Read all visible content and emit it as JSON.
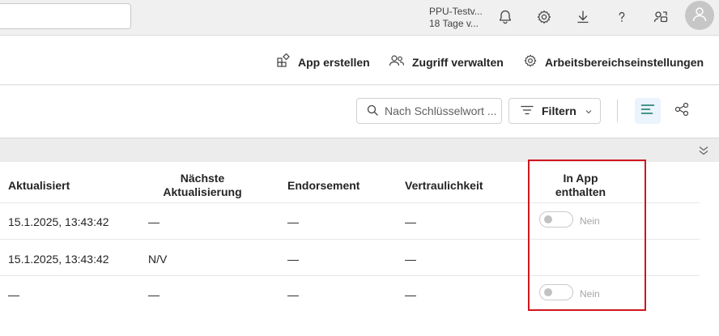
{
  "topbar": {
    "trial_line1": "PPU-Testv...",
    "trial_line2": "18 Tage v...",
    "icons": [
      "bell-icon",
      "gear-icon",
      "download-icon",
      "help-icon",
      "share-icon",
      "user-icon"
    ]
  },
  "actionbar": {
    "create_app": "App erstellen",
    "manage_access": "Zugriff verwalten",
    "workspace_settings": "Arbeitsbereichseinstellungen"
  },
  "toolbar": {
    "search_placeholder": "Nach Schlüsselwort ...",
    "filter_label": "Filtern"
  },
  "table": {
    "columns": {
      "updated": "Aktualisiert",
      "next_refresh_1": "Nächste",
      "next_refresh_2": "Aktualisierung",
      "endorsement": "Endorsement",
      "sensitivity": "Vertraulichkeit",
      "in_app_1": "In App",
      "in_app_2": "enthalten"
    },
    "rows": [
      {
        "updated": "15.1.2025, 13:43:42",
        "next": "—",
        "endorsement": "—",
        "sensitivity": "—",
        "toggle_label": "Nein"
      },
      {
        "updated": "15.1.2025, 13:43:42",
        "next": "N/V",
        "endorsement": "—",
        "sensitivity": "—",
        "toggle_label": ""
      },
      {
        "updated": "—",
        "next": "—",
        "endorsement": "—",
        "sensitivity": "—",
        "toggle_label": "Nein"
      }
    ]
  },
  "colors": {
    "accent": "#117865",
    "highlight": "#d0161e"
  }
}
